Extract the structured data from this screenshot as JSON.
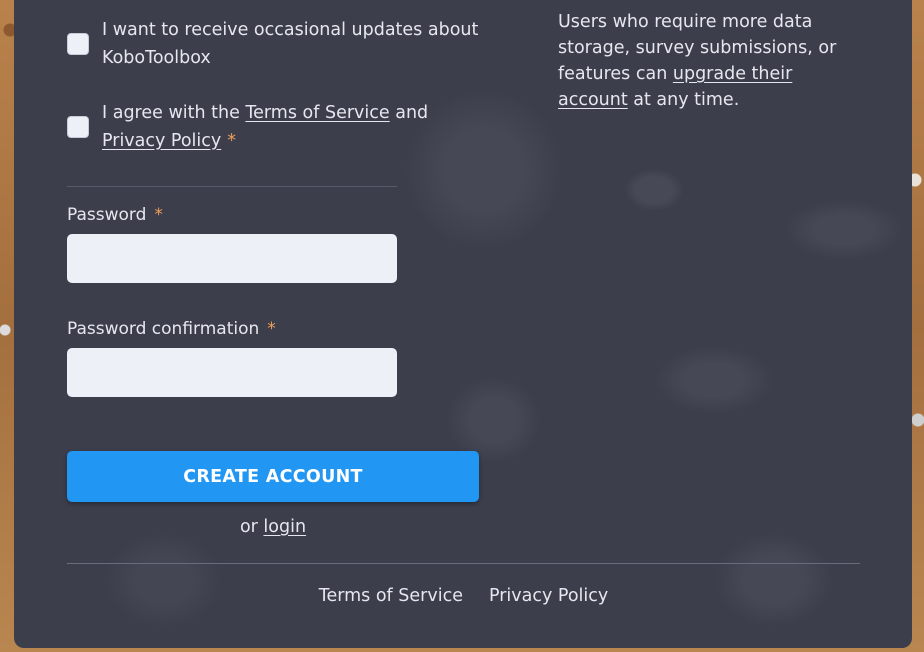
{
  "checkboxes": {
    "updates": {
      "text": "I want to receive occasional updates about KoboToolbox"
    },
    "terms": {
      "prefix": "I agree with the ",
      "terms_link": "Terms of Service",
      "middle": " and",
      "privacy_link": "Privacy Policy",
      "required_mark": "*"
    }
  },
  "fields": {
    "password": {
      "label": "Password",
      "required_mark": "*",
      "value": "",
      "placeholder": ""
    },
    "password_confirmation": {
      "label": "Password confirmation",
      "required_mark": "*",
      "value": "",
      "placeholder": ""
    }
  },
  "actions": {
    "create_account_label": "CREATE ACCOUNT",
    "or_text": "or",
    "login_link": "login"
  },
  "side_note": {
    "text_before": "Users who require more data storage, survey submissions, or features can ",
    "upgrade_link": "upgrade their account",
    "text_after": " at any time."
  },
  "footer": {
    "terms_link": "Terms of Service",
    "privacy_link": "Privacy Policy"
  },
  "colors": {
    "panel_bg": "#3c3e4c",
    "primary_button": "#2196f3",
    "required_mark": "#f0a058",
    "input_bg": "#eef0f8"
  }
}
